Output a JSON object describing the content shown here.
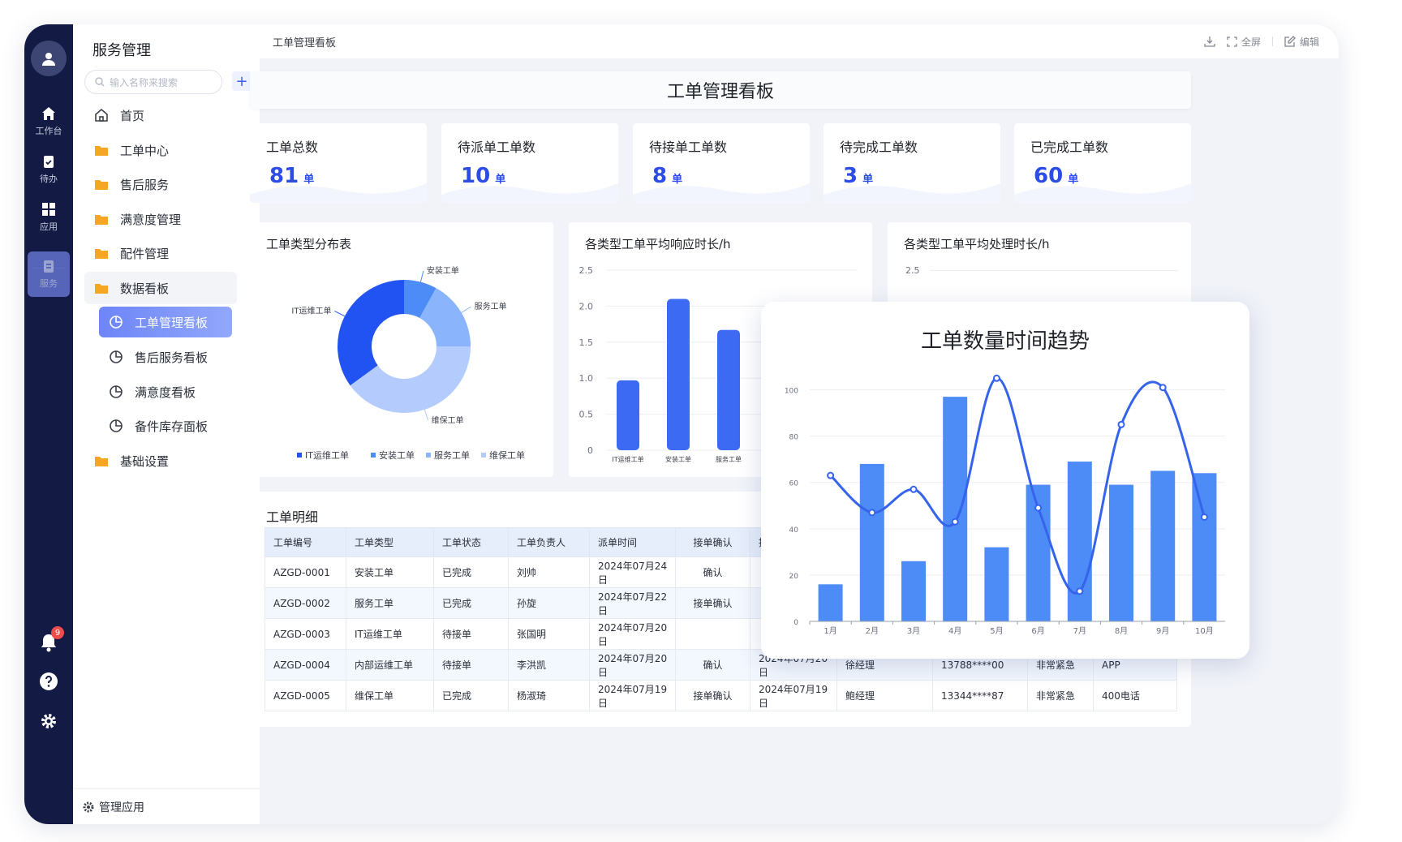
{
  "rail": {
    "items": [
      {
        "label": "工作台",
        "icon": "home-icon"
      },
      {
        "label": "待办",
        "icon": "clipboard-icon"
      },
      {
        "label": "应用",
        "icon": "apps-icon"
      },
      {
        "label": "服务",
        "icon": "service-icon"
      }
    ],
    "notification_count": "9"
  },
  "sidebar": {
    "title": "服务管理",
    "search_placeholder": "输入名称来搜索",
    "items": [
      {
        "label": "首页"
      },
      {
        "label": "工单中心"
      },
      {
        "label": "售后服务"
      },
      {
        "label": "满意度管理"
      },
      {
        "label": "配件管理"
      },
      {
        "label": "数据看板"
      }
    ],
    "sub_items": [
      {
        "label": "工单管理看板"
      },
      {
        "label": "售后服务看板"
      },
      {
        "label": "满意度看板"
      },
      {
        "label": "备件库存面板"
      }
    ],
    "last_item": "基础设置",
    "footer": "管理应用"
  },
  "topbar": {
    "breadcrumb": "工单管理看板",
    "fullscreen": "全屏",
    "edit": "编辑"
  },
  "board_title": "工单管理看板",
  "stats": [
    {
      "label": "工单总数",
      "value": "81",
      "unit": "单"
    },
    {
      "label": "待派单工单数",
      "value": "10",
      "unit": "单"
    },
    {
      "label": "待接单工单数",
      "value": "8",
      "unit": "单"
    },
    {
      "label": "待完成工单数",
      "value": "3",
      "unit": "单"
    },
    {
      "label": "已完成工单数",
      "value": "60",
      "unit": "单"
    }
  ],
  "donut": {
    "title": "工单类型分布表",
    "slices": [
      {
        "name": "IT运维工单",
        "value": 35,
        "color": "#2152f2"
      },
      {
        "name": "安装工单",
        "value": 8,
        "color": "#4d8bf7"
      },
      {
        "name": "服务工单",
        "value": 17,
        "color": "#8ab4fb"
      },
      {
        "name": "维保工单",
        "value": 40,
        "color": "#b4cbfd"
      }
    ]
  },
  "response_chart": {
    "title": "各类型工单平均响应时长/h",
    "yticks": [
      "2.5",
      "2.0",
      "1.5",
      "1.0",
      "0.5",
      "0"
    ],
    "ylim": [
      0,
      2.5
    ],
    "categories": [
      "IT运维工单",
      "安装工单",
      "服务工单"
    ],
    "values": [
      0.97,
      2.1,
      1.67
    ]
  },
  "handle_chart": {
    "title": "各类型工单平均处理时长/h",
    "yticks": [
      "2.5"
    ]
  },
  "table": {
    "title": "工单明细",
    "headers": [
      "工单编号",
      "工单类型",
      "工单状态",
      "工单负责人",
      "派单时间",
      "接单确认",
      "接"
    ],
    "rows": [
      [
        "AZGD-0001",
        "安装工单",
        "已完成",
        "刘帅",
        "2024年07月24日",
        "确认",
        "",
        "",
        "",
        "",
        ""
      ],
      [
        "AZGD-0002",
        "服务工单",
        "已完成",
        "孙旋",
        "2024年07月22日",
        "接单确认",
        "",
        "",
        "",
        "",
        ""
      ],
      [
        "AZGD-0003",
        "IT运维工单",
        "待接单",
        "张国明",
        "2024年07月20日",
        "",
        "",
        "",
        "",
        "",
        ""
      ],
      [
        "AZGD-0004",
        "内部运维工单",
        "待接单",
        "李洪凯",
        "2024年07月20日",
        "确认",
        "2024年07月20日",
        "徐经理",
        "13788****00",
        "非常紧急",
        "APP"
      ],
      [
        "AZGD-0005",
        "维保工单",
        "已完成",
        "杨淑琦",
        "2024年07月19日",
        "接单确认",
        "2024年07月19日",
        "鲍经理",
        "13344****87",
        "非常紧急",
        "400电话"
      ]
    ]
  },
  "chart_data": {
    "type": "bar",
    "title": "工单数量时间趋势",
    "categories": [
      "1月",
      "2月",
      "3月",
      "4月",
      "5月",
      "6月",
      "7月",
      "8月",
      "9月",
      "10月"
    ],
    "yticks": [
      "100",
      "80",
      "60",
      "40",
      "20",
      "0"
    ],
    "ylim": [
      0,
      110
    ],
    "series": [
      {
        "values": [
          16,
          68,
          26,
          97,
          32,
          59,
          69,
          59,
          65,
          64
        ]
      },
      {
        "type": "line",
        "values": [
          63,
          47,
          57,
          43,
          105,
          49,
          13,
          85,
          101,
          45
        ]
      }
    ],
    "colors": {
      "bar": "#4d8bf7",
      "line": "#3563ec"
    }
  }
}
